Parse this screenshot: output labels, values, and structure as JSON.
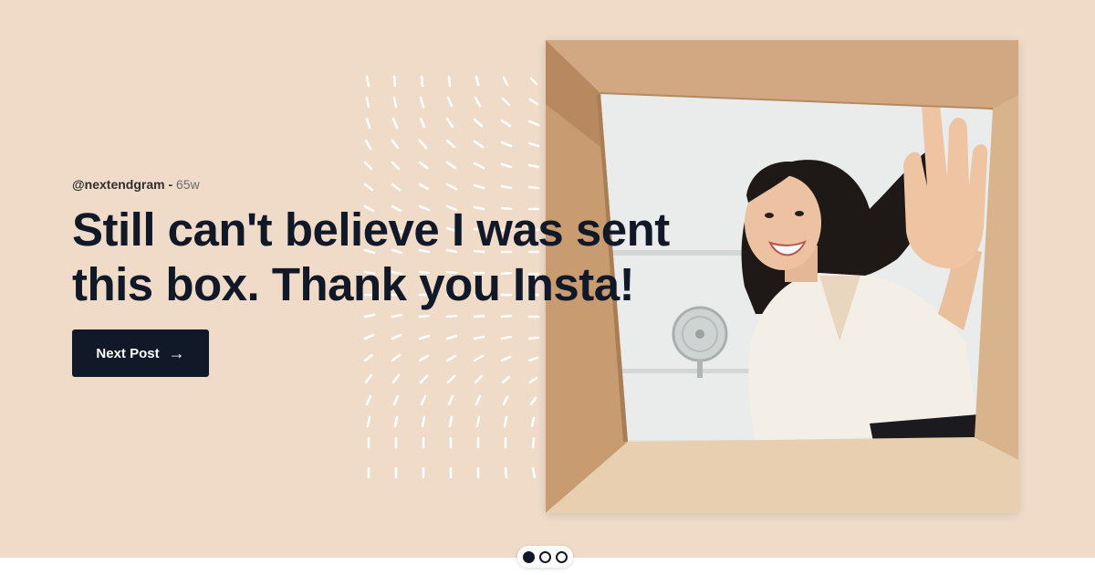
{
  "post": {
    "handle": "@nextendgram",
    "separator": " - ",
    "age": "65w",
    "headline": "Still can't believe I was sent this box. Thank you Insta!"
  },
  "actions": {
    "next_label": "Next Post",
    "next_icon": "arrow-right-icon",
    "next_glyph": "→"
  },
  "carousel": {
    "slides": 3,
    "active_index": 0
  },
  "colors": {
    "background": "#f0dac8",
    "text_dark": "#111827",
    "button": "#111827",
    "pattern": "#ffffff"
  }
}
